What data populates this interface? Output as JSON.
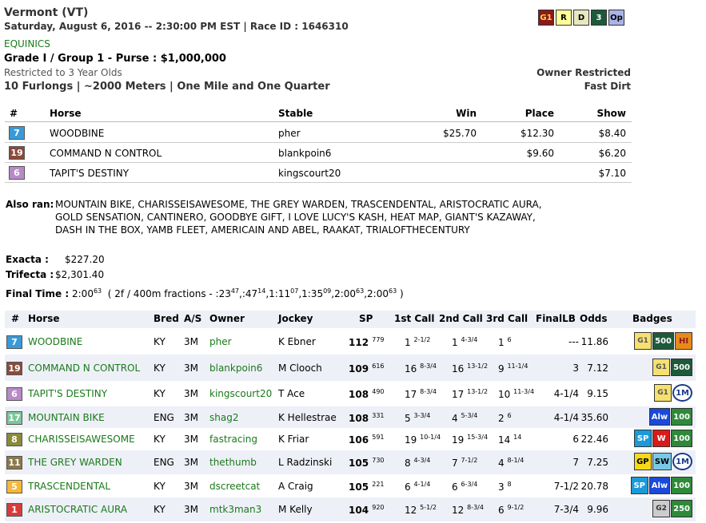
{
  "race": {
    "track": "Vermont (VT)",
    "datetime_line": "Saturday, August 6, 2016 -- 2:30:00 PM EST | Race ID : 1646310",
    "name": "EQUINICS",
    "grade": "Grade I / Group 1 - Purse : $1,000,000",
    "restriction": "Restricted to 3 Year Olds",
    "distance": "10 Furlongs | ~2000 Meters | One Mile and One Quarter",
    "owner_restricted": "Owner Restricted",
    "surface": "Fast Dirt"
  },
  "top_icons": [
    {
      "label": "G1",
      "bg": "#8b1a1a",
      "fg": "#ffdd33"
    },
    {
      "label": "R",
      "bg": "#ffff99",
      "fg": "#000000"
    },
    {
      "label": "D",
      "bg": "#e8e8c0",
      "fg": "#000000"
    },
    {
      "label": "3",
      "bg": "#1e5a3a",
      "fg": "#ffffff"
    },
    {
      "label": "Op",
      "bg": "#aab4e8",
      "fg": "#000000"
    }
  ],
  "results": {
    "headers": {
      "num": "#",
      "horse": "Horse",
      "stable": "Stable",
      "win": "Win",
      "place": "Place",
      "show": "Show"
    },
    "rows": [
      {
        "num": "7",
        "color": "#3a9ad9",
        "horse": "WOODBINE",
        "stable": "pher",
        "win": "$25.70",
        "place": "$12.30",
        "show": "$8.40"
      },
      {
        "num": "19",
        "color": "#8b4a3a",
        "horse": "COMMAND N CONTROL",
        "stable": "blankpoin6",
        "win": "",
        "place": "$9.60",
        "show": "$6.20"
      },
      {
        "num": "6",
        "color": "#b88ac8",
        "horse": "TAPIT'S DESTINY",
        "stable": "kingscourt20",
        "win": "",
        "place": "",
        "show": "$7.10"
      }
    ]
  },
  "also_ran": {
    "label": "Also ran:",
    "line1": "MOUNTAIN BIKE, CHARISSEISAWESOME, THE GREY WARDEN, TRASCENDENTAL, ARISTOCRATIC AURA,",
    "line2": "GOLD SENSATION, CANTINERO, GOODBYE GIFT, I LOVE LUCY'S KASH, HEAT MAP, GIANT'S KAZAWAY,",
    "line3": "DASH IN THE BOX, YAMB FLEET, AMERICAIN AND ABEL, RAAKAT, TRIALOFTHECENTURY"
  },
  "payouts": {
    "exacta_label": "Exacta :",
    "exacta": "$227.20",
    "trifecta_label": "Trifecta :",
    "trifecta": "$2,301.40"
  },
  "final_time": {
    "label": "Final Time :",
    "time": "2:00",
    "time_sup": "63",
    "fr_prefix": "( 2f / 400m fractions - :23",
    "f1": "47",
    "t2": ",:47",
    "f2": "14",
    "t3": ",1:11",
    "f3": "07",
    "t4": ",1:35",
    "f4": "09",
    "t5": ",2:00",
    "f5": "63",
    "t6": ",2:00",
    "f6": "63",
    "close": " )"
  },
  "main": {
    "headers": {
      "num": "#",
      "horse": "Horse",
      "bred": "Bred",
      "age": "A/S",
      "owner": "Owner",
      "jockey": "Jockey",
      "sp": "SP",
      "c1": "1st Call",
      "c2": "2nd Call",
      "c3": "3rd Call",
      "flb": "FinalLB",
      "odds": "Odds",
      "badges": "Badges"
    },
    "rows": [
      {
        "num": "7",
        "color": "#3a9ad9",
        "horse": "WOODBINE",
        "bred": "KY",
        "age": "3M",
        "owner": "pher",
        "jockey": "K Ebner",
        "sp": "112",
        "sp_sup": "779",
        "c1": "1",
        "c1s": "2-1/2",
        "c2": "1",
        "c2s": "4-3/4",
        "c3": "1",
        "c3s": "6",
        "flb": "---",
        "odds": "11.86",
        "badges": [
          {
            "t": "G1",
            "bg": "#f5e070",
            "fg": "#555",
            "n": "g1-star-icon"
          },
          {
            "t": "500",
            "bg": "#1e5a3a",
            "fg": "#fff",
            "n": "500-icon"
          },
          {
            "t": "HI",
            "bg": "#e88a1a",
            "fg": "#8b1a1a",
            "n": "hi-icon"
          }
        ]
      },
      {
        "num": "19",
        "color": "#8b4a3a",
        "horse": "COMMAND N CONTROL",
        "bred": "KY",
        "age": "3M",
        "owner": "blankpoin6",
        "jockey": "M Clooch",
        "sp": "109",
        "sp_sup": "616",
        "c1": "16",
        "c1s": "8-3/4",
        "c2": "16",
        "c2s": "13-1/2",
        "c3": "9",
        "c3s": "11-1/4",
        "flb": "3",
        "odds": "7.12",
        "badges": [
          {
            "t": "G1",
            "bg": "#f5e070",
            "fg": "#555",
            "n": "g1-star-icon"
          },
          {
            "t": "500",
            "bg": "#1e5a3a",
            "fg": "#fff",
            "n": "500-icon"
          }
        ]
      },
      {
        "num": "6",
        "color": "#b88ac8",
        "horse": "TAPIT'S DESTINY",
        "bred": "KY",
        "age": "3M",
        "owner": "kingscourt20",
        "jockey": "T Ace",
        "sp": "108",
        "sp_sup": "490",
        "c1": "17",
        "c1s": "8-3/4",
        "c2": "17",
        "c2s": "13-1/2",
        "c3": "10",
        "c3s": "11-3/4",
        "flb": "4-1/4",
        "odds": "9.15",
        "badges": [
          {
            "t": "G1",
            "bg": "#f5e070",
            "fg": "#555",
            "n": "g1-star-icon"
          },
          {
            "t": "1M",
            "bg": "#ffffff",
            "fg": "#1a3a8a",
            "n": "1m-icon"
          }
        ]
      },
      {
        "num": "17",
        "color": "#7ac89a",
        "horse": "MOUNTAIN BIKE",
        "bred": "ENG",
        "age": "3M",
        "owner": "shag2",
        "jockey": "K Hellestrae",
        "sp": "108",
        "sp_sup": "331",
        "c1": "5",
        "c1s": "3-3/4",
        "c2": "4",
        "c2s": "5-3/4",
        "c3": "2",
        "c3s": "6",
        "flb": "4-1/4",
        "odds": "35.60",
        "badges": [
          {
            "t": "Alw",
            "bg": "#1a4ad9",
            "fg": "#fff",
            "n": "alw-icon"
          },
          {
            "t": "100",
            "bg": "#2e8a3a",
            "fg": "#fff",
            "n": "100-icon"
          }
        ]
      },
      {
        "num": "8",
        "color": "#8a8a3a",
        "horse": "CHARISSEISAWESOME",
        "bred": "KY",
        "age": "3M",
        "owner": "fastracing",
        "jockey": "K Friar",
        "sp": "106",
        "sp_sup": "591",
        "c1": "19",
        "c1s": "10-1/4",
        "c2": "19",
        "c2s": "15-3/4",
        "c3": "14",
        "c3s": "14",
        "flb": "6",
        "odds": "22.46",
        "badges": [
          {
            "t": "SP",
            "bg": "#1a9ad9",
            "fg": "#fff",
            "n": "sp-icon"
          },
          {
            "t": "W",
            "bg": "#d91a1a",
            "fg": "#fff",
            "n": "w-icon"
          },
          {
            "t": "100",
            "bg": "#2e8a3a",
            "fg": "#fff",
            "n": "100-icon"
          }
        ]
      },
      {
        "num": "11",
        "color": "#8a7a4a",
        "horse": "THE GREY WARDEN",
        "bred": "ENG",
        "age": "3M",
        "owner": "thethumb",
        "jockey": "L Radzinski",
        "sp": "105",
        "sp_sup": "730",
        "c1": "8",
        "c1s": "4-3/4",
        "c2": "7",
        "c2s": "7-1/2",
        "c3": "4",
        "c3s": "8-1/4",
        "flb": "7",
        "odds": "7.25",
        "badges": [
          {
            "t": "GP",
            "bg": "#f5d91a",
            "fg": "#000",
            "n": "gp-icon"
          },
          {
            "t": "SW",
            "bg": "#7ac8e8",
            "fg": "#000",
            "n": "sw-icon"
          },
          {
            "t": "1M",
            "bg": "#ffffff",
            "fg": "#1a3a8a",
            "n": "1m-icon"
          }
        ]
      },
      {
        "num": "5",
        "color": "#f5b83a",
        "horse": "TRASCENDENTAL",
        "bred": "KY",
        "age": "3M",
        "owner": "dscreetcat",
        "jockey": "A Craig",
        "sp": "105",
        "sp_sup": "221",
        "c1": "6",
        "c1s": "4-1/4",
        "c2": "6",
        "c2s": "6-3/4",
        "c3": "3",
        "c3s": "8",
        "flb": "7-1/2",
        "odds": "20.78",
        "badges": [
          {
            "t": "SP",
            "bg": "#1a9ad9",
            "fg": "#fff",
            "n": "sp-icon"
          },
          {
            "t": "Alw",
            "bg": "#1a4ad9",
            "fg": "#fff",
            "n": "alw-icon"
          },
          {
            "t": "100",
            "bg": "#2e8a3a",
            "fg": "#fff",
            "n": "100-icon"
          }
        ]
      },
      {
        "num": "1",
        "color": "#d93a3a",
        "horse": "ARISTOCRATIC AURA",
        "bred": "KY",
        "age": "3M",
        "owner": "mtk3man3",
        "jockey": "M Kelly",
        "sp": "104",
        "sp_sup": "920",
        "c1": "12",
        "c1s": "5-1/2",
        "c2": "12",
        "c2s": "8-3/4",
        "c3": "6",
        "c3s": "9-1/2",
        "flb": "7-3/4",
        "odds": "9.96",
        "badges": [
          {
            "t": "G2",
            "bg": "#cccccc",
            "fg": "#333",
            "n": "g2-star-icon"
          },
          {
            "t": "250",
            "bg": "#2e8a3a",
            "fg": "#fff",
            "n": "250-icon"
          }
        ]
      }
    ]
  }
}
